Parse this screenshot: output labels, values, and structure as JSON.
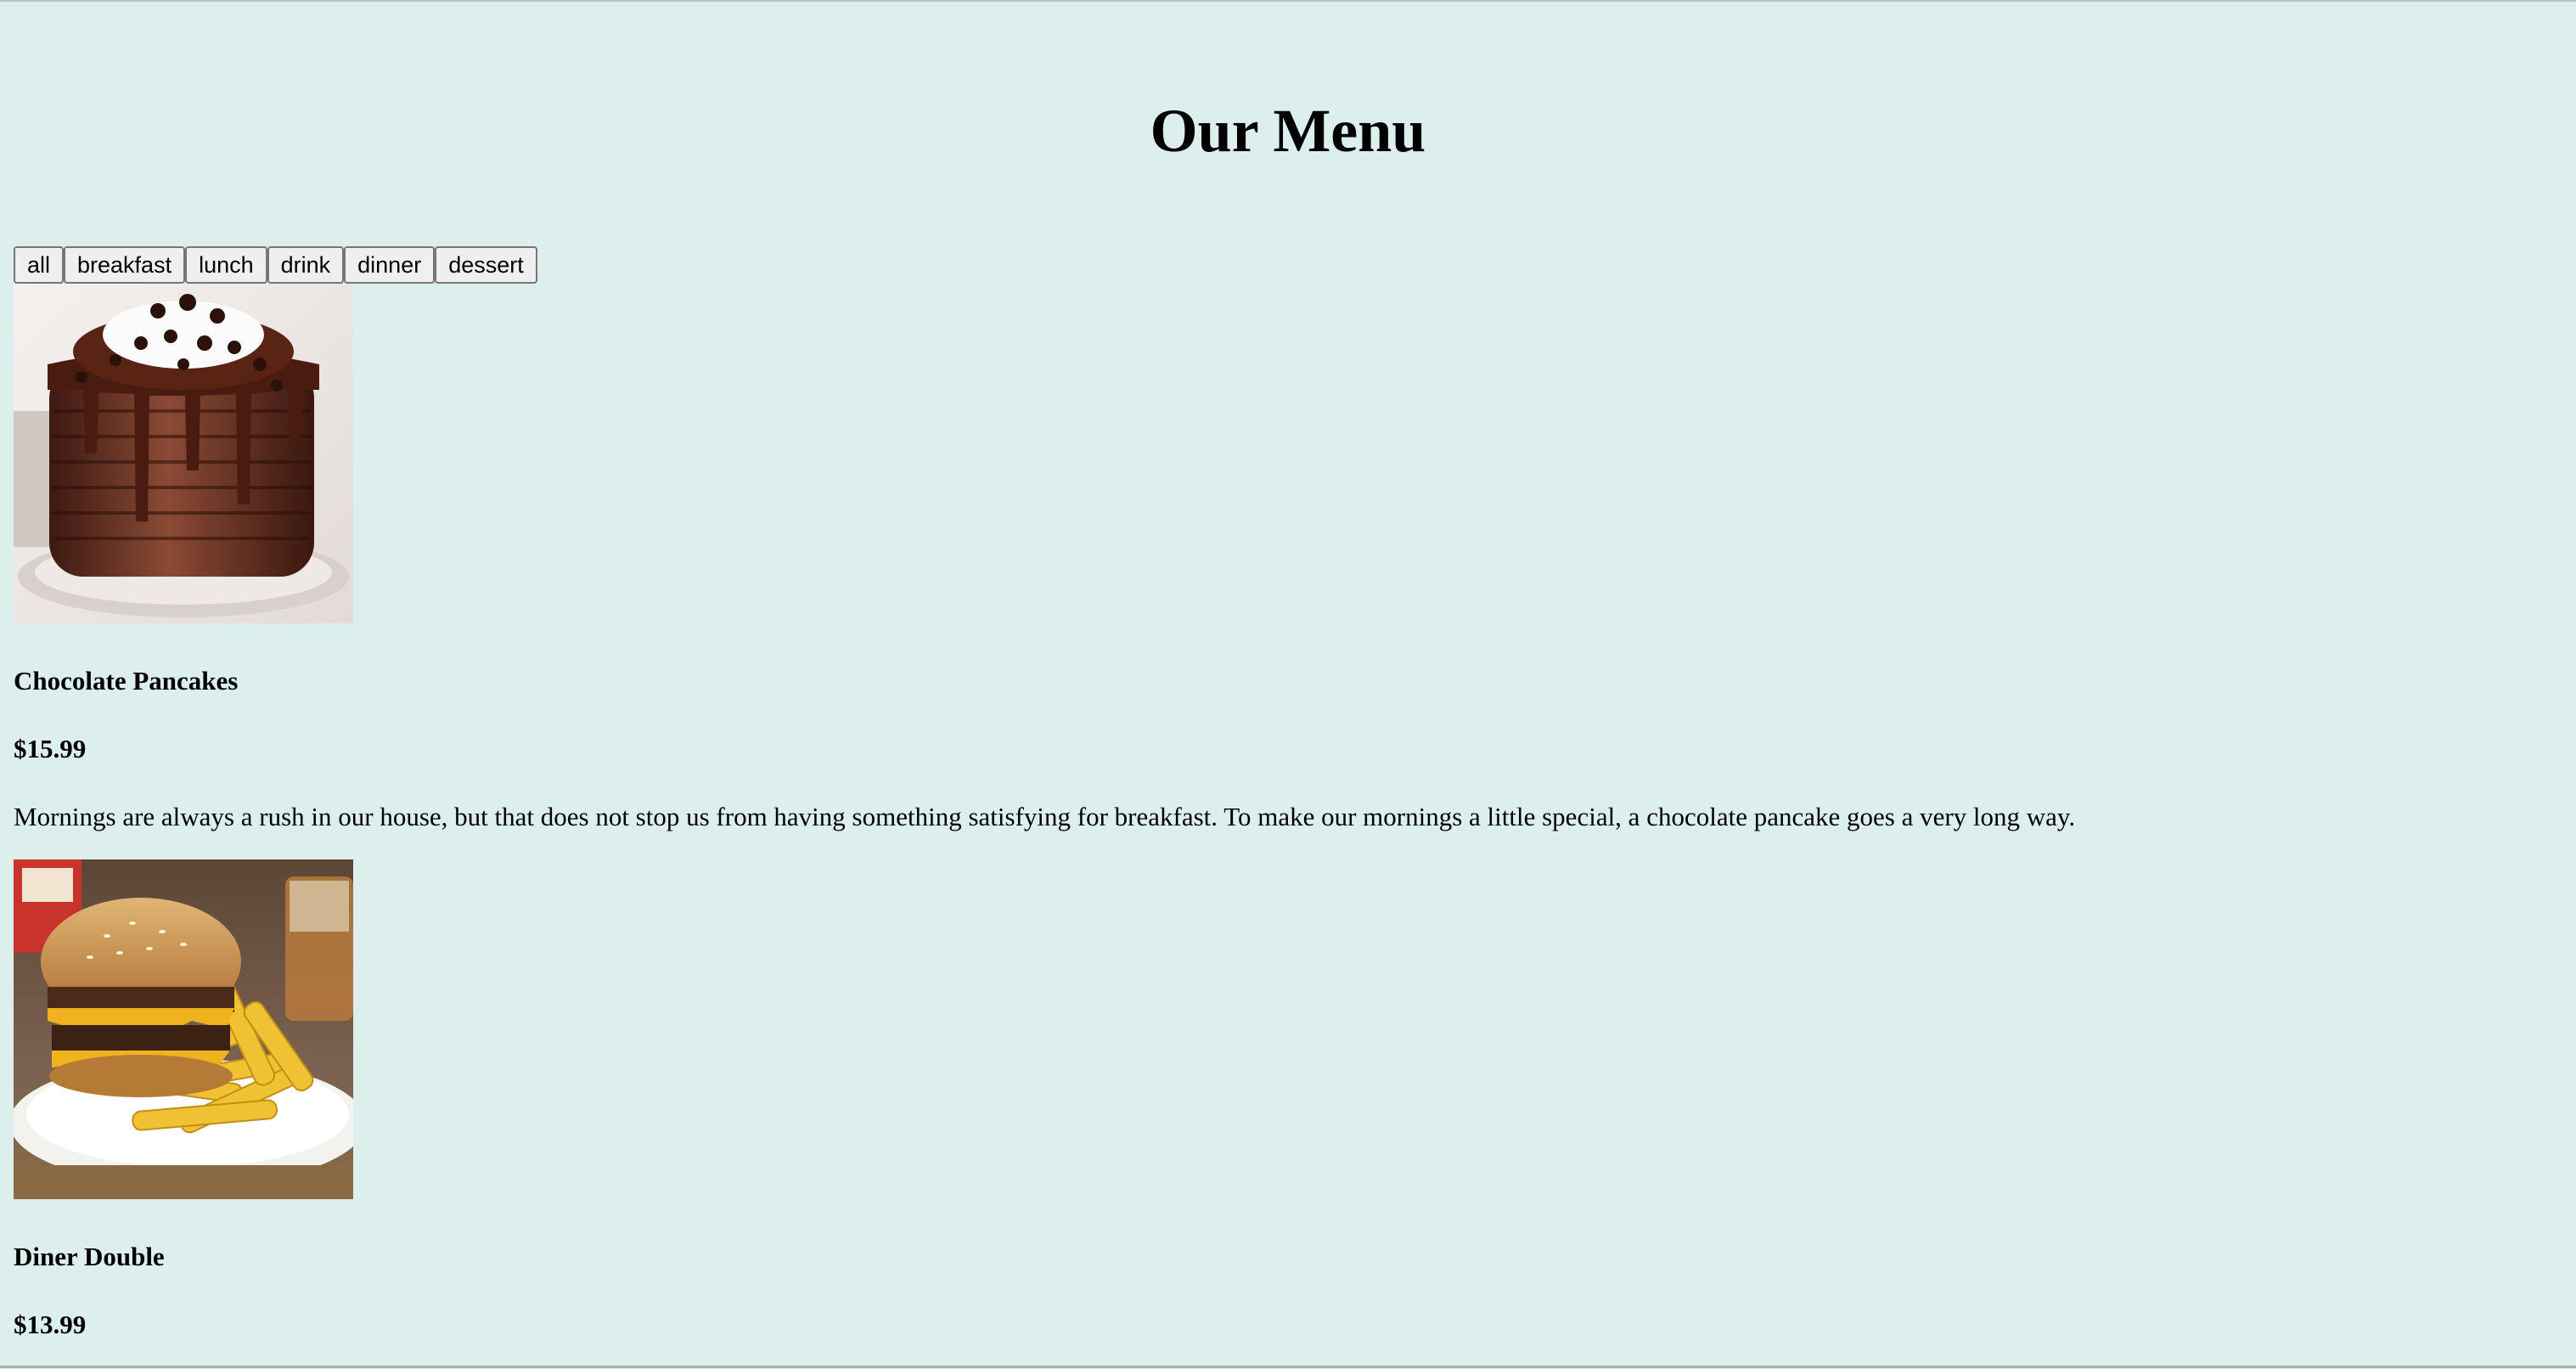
{
  "page": {
    "title": "Our Menu",
    "background": "#dcefed"
  },
  "filters": [
    {
      "label": "all"
    },
    {
      "label": "breakfast"
    },
    {
      "label": "lunch"
    },
    {
      "label": "drink"
    },
    {
      "label": "dinner"
    },
    {
      "label": "dessert"
    }
  ],
  "items": [
    {
      "image": "chocolate-pancake-stack",
      "name": "Chocolate Pancakes",
      "price": "$15.99",
      "description": "Mornings are always a rush in our house, but that does not stop us from having something satisfying for breakfast. To make our mornings a little special, a chocolate pancake goes a very long way."
    },
    {
      "image": "burger-and-fries",
      "name": "Diner Double",
      "price": "$13.99",
      "description": ""
    }
  ]
}
